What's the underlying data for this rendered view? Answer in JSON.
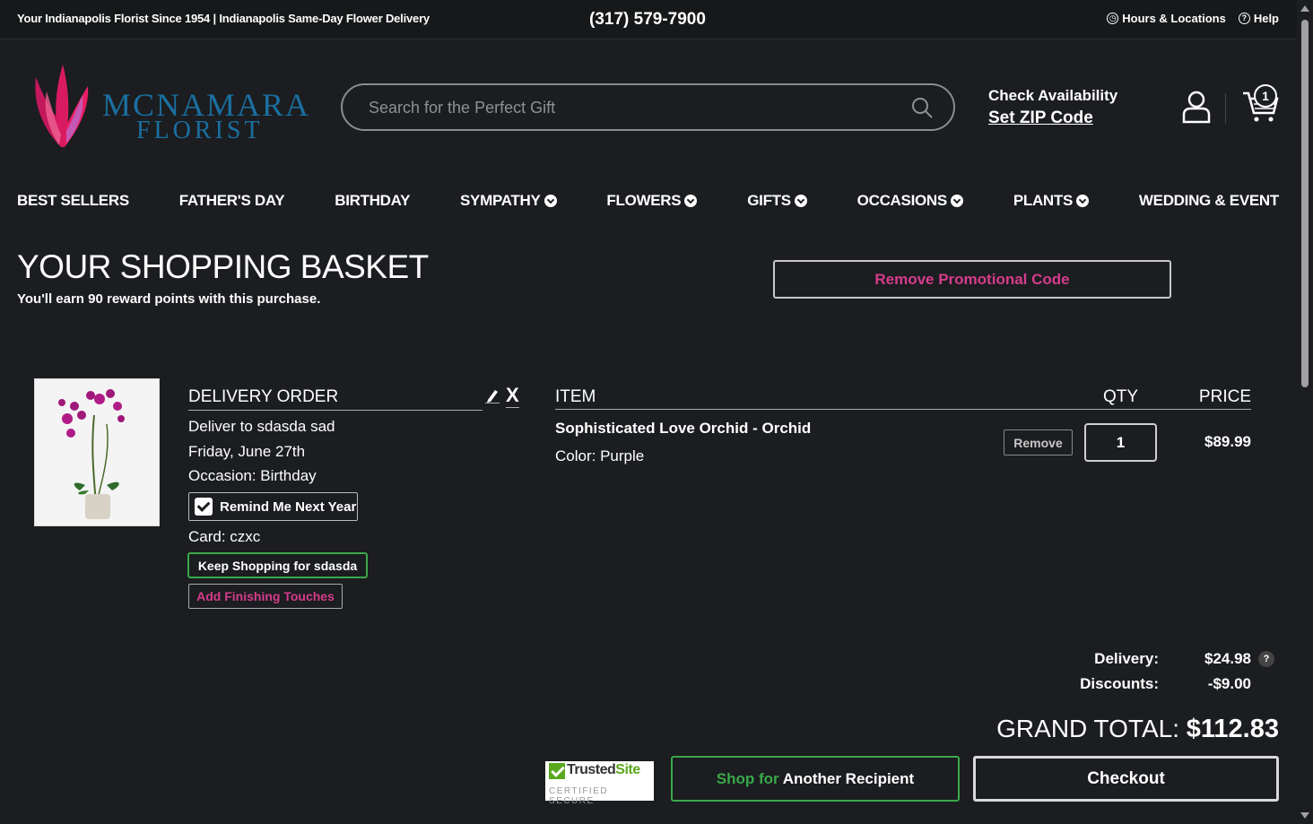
{
  "topbar": {
    "tagline": "Your Indianapolis Florist Since 1954 | Indianapolis Same-Day Flower Delivery",
    "phone": "(317) 579-7900",
    "hours_label": "Hours & Locations",
    "help_label": "Help"
  },
  "logo": {
    "line1": "MCNAMARA",
    "line2": "FLORIST"
  },
  "search": {
    "placeholder": "Search for the Perfect Gift"
  },
  "zip": {
    "check_label": "Check Availability",
    "set_label": "Set ZIP Code"
  },
  "cart": {
    "count": "1"
  },
  "nav": [
    {
      "label": "BEST SELLERS",
      "dropdown": false
    },
    {
      "label": "FATHER'S DAY",
      "dropdown": false
    },
    {
      "label": "BIRTHDAY",
      "dropdown": false
    },
    {
      "label": "SYMPATHY",
      "dropdown": true
    },
    {
      "label": "FLOWERS",
      "dropdown": true
    },
    {
      "label": "GIFTS",
      "dropdown": true
    },
    {
      "label": "OCCASIONS",
      "dropdown": true
    },
    {
      "label": "PLANTS",
      "dropdown": true
    },
    {
      "label": "WEDDING & EVENT",
      "dropdown": false
    }
  ],
  "basket": {
    "title": "YOUR SHOPPING BASKET",
    "reward_text": "You'll earn 90 reward points with this purchase.",
    "promo_button": "Remove Promotional Code"
  },
  "delivery": {
    "heading": "DELIVERY ORDER",
    "deliver_to": "Deliver to sdasda sad",
    "date": "Friday, June 27th",
    "occasion": "Occasion: Birthday",
    "remind_label": "Remind Me Next Year",
    "remind_checked": true,
    "card": "Card: czxc",
    "keep_shopping": "Keep Shopping for sdasda",
    "finishing": "Add Finishing Touches"
  },
  "items": {
    "headers": {
      "item": "ITEM",
      "qty": "QTY",
      "price": "PRICE"
    },
    "rows": [
      {
        "name": "Sophisticated Love Orchid - Orchid",
        "color": "Color: Purple",
        "remove_label": "Remove",
        "qty": "1",
        "price": "$89.99"
      }
    ]
  },
  "totals": {
    "delivery_label": "Delivery:",
    "delivery_value": "$24.98",
    "delivery_help": "?",
    "discounts_label": "Discounts:",
    "discounts_value": "-$9.00",
    "grand_label": "GRAND TOTAL:",
    "grand_value": "$112.83"
  },
  "footer": {
    "trusted_a": "Trusted",
    "trusted_b": "Site",
    "trusted_sub": "CERTIFIED SECURE",
    "shop_for": "Shop for",
    "another_recipient": "Another Recipient",
    "checkout": "Checkout"
  },
  "colors": {
    "background": "#1b1d20",
    "accent_pink": "#d63c8c",
    "accent_green": "#3aa84a",
    "logo_blue": "#1a6fa0"
  }
}
